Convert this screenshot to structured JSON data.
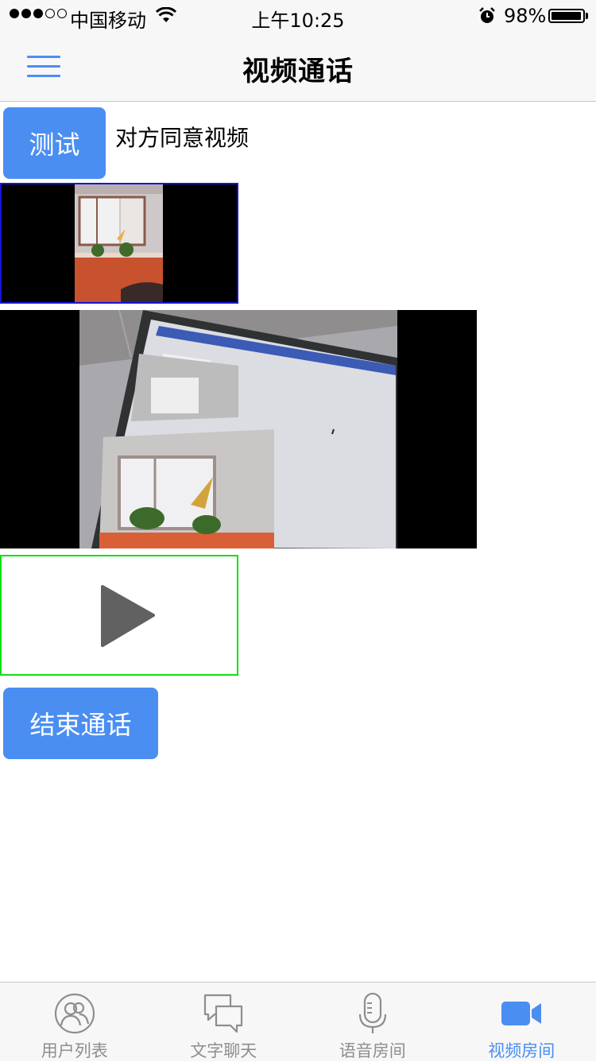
{
  "status_bar": {
    "carrier": "中国移动",
    "time": "上午10:25",
    "battery": "98%",
    "battery_level": 0.98
  },
  "nav": {
    "title": "视频通话"
  },
  "content": {
    "test_button": "测试",
    "status_text": "对方同意视频",
    "end_call_button": "结束通话"
  },
  "tabs": [
    {
      "label": "用户列表",
      "icon": "users-icon",
      "active": false
    },
    {
      "label": "文字聊天",
      "icon": "chat-bubbles-icon",
      "active": false
    },
    {
      "label": "语音房间",
      "icon": "microphone-icon",
      "active": false
    },
    {
      "label": "视频房间",
      "icon": "video-camera-icon",
      "active": true
    }
  ],
  "colors": {
    "accent": "#4a8ef2",
    "local_video_border": "#1515d8",
    "player_border": "#12e012",
    "tab_inactive": "#8e8e8e"
  }
}
